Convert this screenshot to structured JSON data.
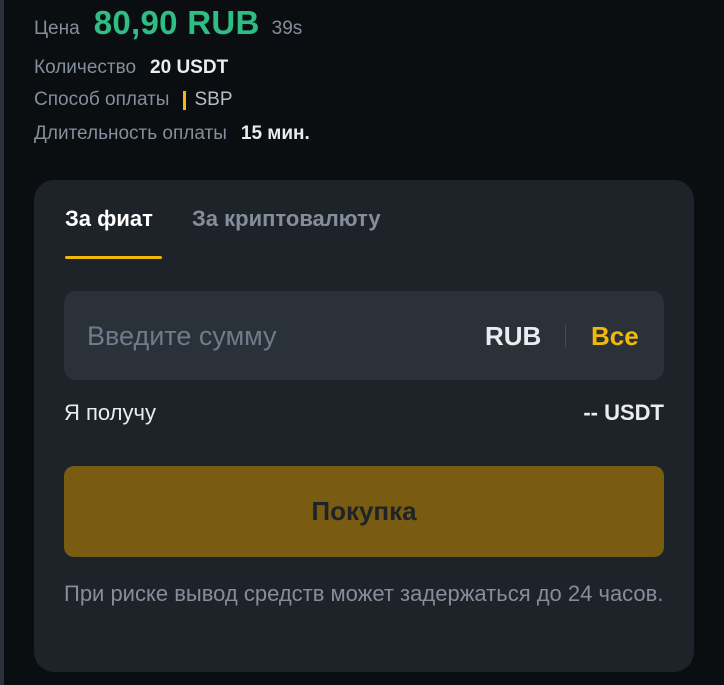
{
  "order_info": {
    "price_label": "Цена",
    "price_value": "80,90 RUB",
    "timer": "39s",
    "quantity_label": "Количество",
    "quantity_value": "20 USDT",
    "payment_label": "Способ оплаты",
    "payment_value": "SBP",
    "duration_label": "Длительность оплаты",
    "duration_value": "15 мин."
  },
  "tabs": [
    {
      "label": "За фиат",
      "active": true
    },
    {
      "label": "За криптовалюту",
      "active": false
    }
  ],
  "amount": {
    "placeholder": "Введите сумму",
    "value": "",
    "currency": "RUB",
    "all_label": "Все"
  },
  "receive": {
    "label": "Я получу",
    "value": "-- USDT"
  },
  "buy_button": {
    "label": "Покупка"
  },
  "warning": "При риске вывод средств может задержаться до 24 часов.",
  "colors": {
    "background": "#0b0e11",
    "card": "#1e2329",
    "price_green": "#2ebd85",
    "accent_yellow": "#f0b90b",
    "buy_button_disabled": "#7a5b12"
  }
}
